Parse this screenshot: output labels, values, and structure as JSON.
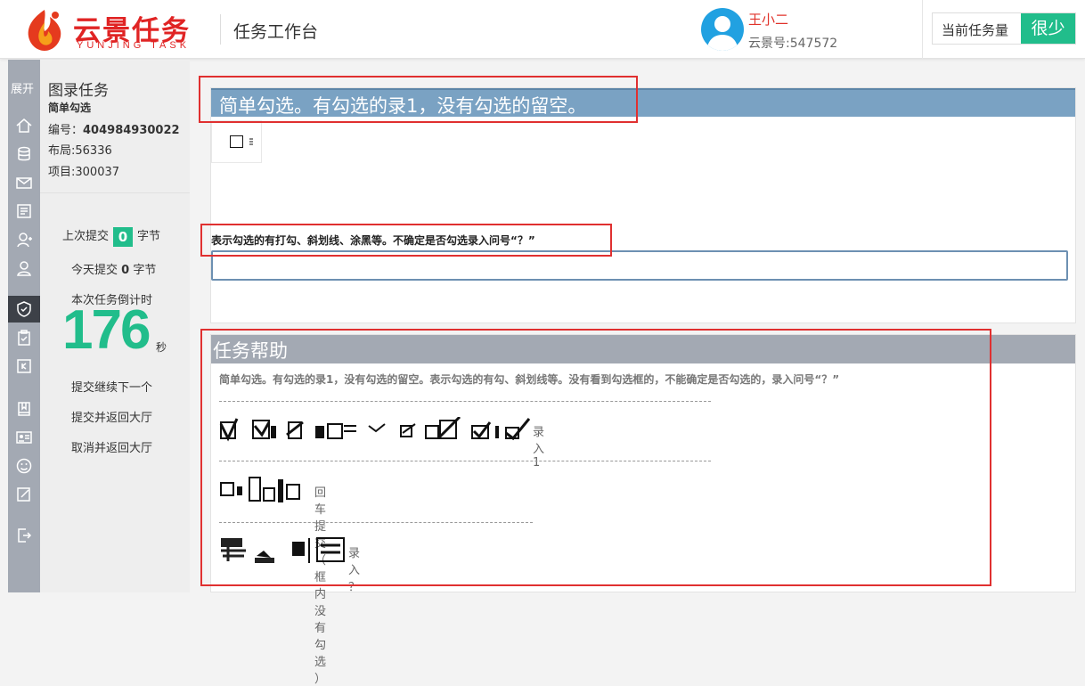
{
  "header": {
    "logo_cn": "云景任务",
    "logo_en": "YUNJING TASK",
    "title": "任务工作台",
    "user_name": "王小二",
    "user_id": "云景号:547572",
    "load_label": "当前任务量",
    "load_value": "很少"
  },
  "rail": {
    "expand_label": "展开",
    "icons": [
      "home-icon",
      "database-icon",
      "mail-icon",
      "document-icon",
      "user-add-icon",
      "user-icon",
      "shield-check-icon",
      "clipboard-icon",
      "key-icon",
      "book-icon",
      "id-card-icon",
      "smile-icon",
      "edit-icon",
      "logout-icon"
    ]
  },
  "info": {
    "title": "图录任务",
    "subtitle": "简单勾选",
    "id_label": "编号：",
    "id_value": "404984930022",
    "layout": "布局:56336",
    "project": "项目:300037",
    "last_submit_label": "上次提交",
    "last_submit_value": "0",
    "last_submit_unit": "字节",
    "today_label": "今天提交",
    "today_value": "0",
    "today_unit": "字节",
    "countdown_label": "本次任务倒计时",
    "countdown_value": "176",
    "countdown_unit": "秒",
    "actions": [
      "提交继续下一个",
      "提交并返回大厅",
      "取消并返回大厅"
    ]
  },
  "task": {
    "heading": "简单勾选。有勾选的录1，没有勾选的留空。",
    "hint": "表示勾选的有打勾、斜划线、涂黑等。不确定是否勾选录入问号“？”",
    "answer_value": ""
  },
  "help": {
    "heading": "任务帮助",
    "text": "简单勾选。有勾选的录1，没有勾选的留空。表示勾选的有勾、斜划线等。没有看到勾选框的，不能确定是否勾选的，录入问号“？”",
    "samples": [
      {
        "label": "录入 1"
      },
      {
        "label": "回车提交 （ 框内没有勾选 ）"
      },
      {
        "label": "录入 ？"
      }
    ]
  },
  "colors": {
    "accent_green": "#21bd8b",
    "brand_red": "#e02424",
    "task_header": "#7aa2c3",
    "help_header": "#a3a9b3",
    "highlight_red": "#e03030"
  }
}
